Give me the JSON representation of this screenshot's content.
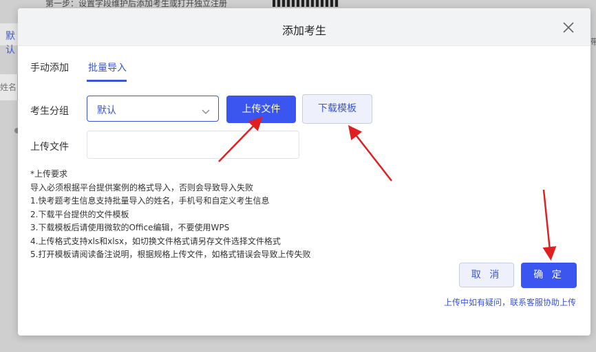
{
  "background": {
    "top_text": "第一步：设置字段维护后添加考生或打开独立注册",
    "left_tab": "默认",
    "left_field": "姓名",
    "right_char": "带"
  },
  "modal": {
    "title": "添加考生",
    "tabs": [
      {
        "label": "手动添加",
        "active": false
      },
      {
        "label": "批量导入",
        "active": true
      }
    ],
    "group_label": "考生分组",
    "group_value": "默认",
    "upload_button": "上传文件",
    "download_button": "下载模板",
    "file_label": "上传文件",
    "requirements": [
      "*上传要求",
      "导入必须根据平台提供案例的格式导入，否则会导致导入失败",
      "1.快考题考生信息支持批量导入的姓名，手机号和自定义考生信息",
      "2.下载平台提供的文件模板",
      "3.下载模板后请使用微软的Office编辑，不要使用WPS",
      "4.上传格式支持xls和xlsx，如切换文件格式请另存文件选择文件格式",
      "5.打开模板请阅读备注说明，根据规格上传文件，如格式错误会导致上传失败"
    ],
    "cancel_button": "取 消",
    "confirm_button": "确 定",
    "help_link": "上传中如有疑问，联系客服协助上传"
  },
  "colors": {
    "primary": "#3a55f0",
    "link": "#3a55d9",
    "annotation_arrow": "#e02020"
  }
}
